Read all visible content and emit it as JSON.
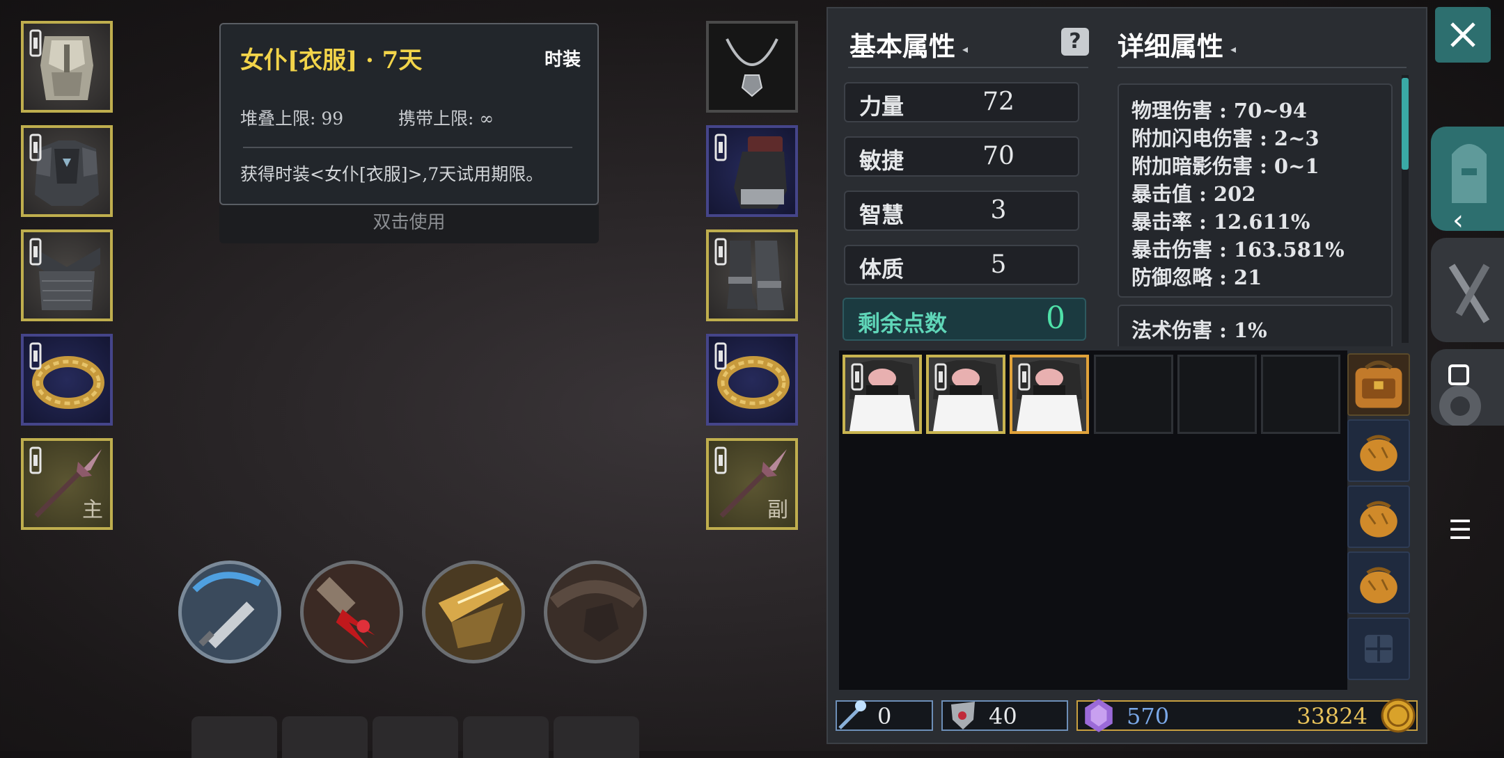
{
  "tooltip": {
    "title": "女仆[衣服] · 7天",
    "type": "时装",
    "stack_label": "堆叠上限: 99",
    "carry_label": "携带上限: ∞",
    "description": "获得时装<女仆[衣服]>,7天试用期限。",
    "use_hint": "双击使用"
  },
  "equipment_left": {
    "slots": [
      {
        "item": "helmet-icon"
      },
      {
        "item": "chest-armor-icon"
      },
      {
        "item": "leg-armor-icon"
      },
      {
        "item": "ring-icon"
      },
      {
        "item": "spear-icon",
        "tag": "主"
      }
    ]
  },
  "equipment_right": {
    "slots": [
      {
        "item": "necklace-icon"
      },
      {
        "item": "gloves-icon"
      },
      {
        "item": "boots-icon"
      },
      {
        "item": "ring-icon"
      },
      {
        "item": "spear-icon",
        "tag": "副"
      }
    ]
  },
  "basic_attributes": {
    "title": "基本属性",
    "stats": [
      {
        "label": "力量",
        "value": "72"
      },
      {
        "label": "敏捷",
        "value": "70"
      },
      {
        "label": "智慧",
        "value": "3"
      },
      {
        "label": "体质",
        "value": "5"
      }
    ],
    "remaining_label": "剩余点数",
    "remaining_value": "0"
  },
  "detailed_attributes": {
    "title": "详细属性",
    "lines": [
      "物理伤害 : 70~94",
      "附加闪电伤害 : 2~3",
      "附加暗影伤害 : 0~1",
      "暴击值 : 202",
      "暴击率 : 12.611%",
      "暴击伤害 : 163.581%",
      "防御忽略 : 21"
    ],
    "lines2": [
      "法术伤害 : 1%"
    ]
  },
  "currency": {
    "wand": "0",
    "shield": "40",
    "crystal": "570",
    "gold": "33824"
  },
  "colors": {
    "gold_border": "#bfae4e",
    "blue_border": "#45458a",
    "accent_teal": "#2d6f6f",
    "title_yellow": "#f2d44a",
    "remain_green": "#4fe0a8"
  }
}
